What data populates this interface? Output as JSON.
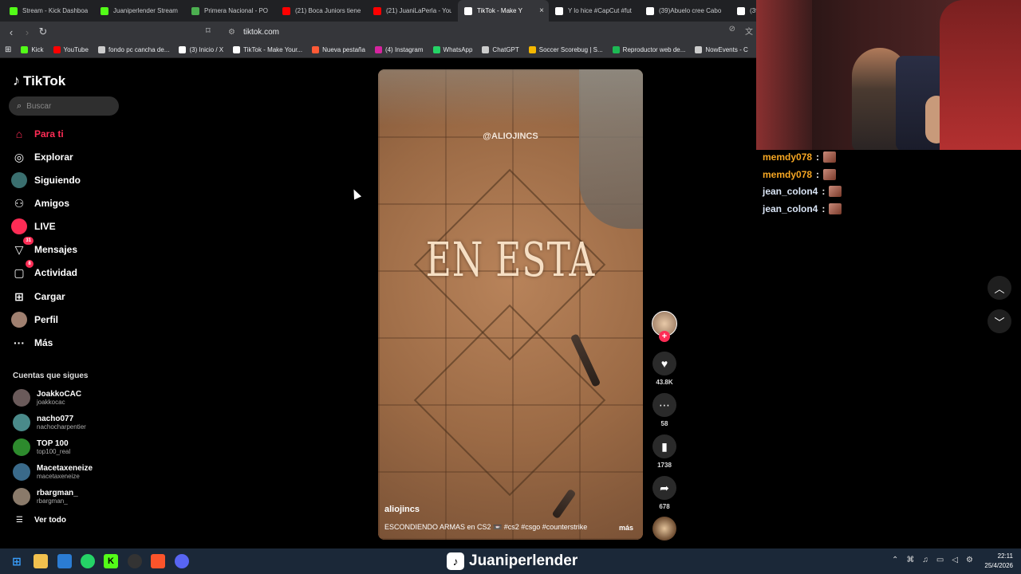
{
  "browser": {
    "tabs": [
      {
        "label": "Stream - Kick Dashboa",
        "icon": "kick-icon",
        "color": "#53fc18",
        "active": false
      },
      {
        "label": "Juaniperlender Stream",
        "icon": "kick-icon",
        "color": "#53fc18",
        "active": false
      },
      {
        "label": "Primera Nacional - PO",
        "icon": "sports-icon",
        "color": "#4caf50",
        "active": false
      },
      {
        "label": "(21) Boca Juniors tiene",
        "icon": "youtube-icon",
        "color": "#ff0000",
        "active": false
      },
      {
        "label": "(21) JuaniLaPerla - You",
        "icon": "youtube-icon",
        "color": "#ff0000",
        "active": false
      },
      {
        "label": "TikTok - Make Y",
        "icon": "tiktok-icon",
        "color": "#ffffff",
        "active": true
      },
      {
        "label": "Y lo hice #CapCut #fut",
        "icon": "tiktok-icon",
        "color": "#ffffff",
        "active": false
      },
      {
        "label": "(39)Abuelo cree Cabo",
        "icon": "tiktok-icon",
        "color": "#ffffff",
        "active": false
      },
      {
        "label": "(39",
        "icon": "tiktok-icon",
        "color": "#ffffff",
        "active": false
      }
    ],
    "url": "tiktok.com",
    "bookmarks": [
      {
        "label": "Kick",
        "color": "#53fc18"
      },
      {
        "label": "YouTube",
        "color": "#ff0000"
      },
      {
        "label": "fondo pc cancha de...",
        "color": "#cccccc"
      },
      {
        "label": "(3) Inicio / X",
        "color": "#ffffff"
      },
      {
        "label": "TikTok - Make Your...",
        "color": "#ffffff"
      },
      {
        "label": "Nueva pestaña",
        "color": "#ff5a36"
      },
      {
        "label": "(4) Instagram",
        "color": "#d6249f"
      },
      {
        "label": "WhatsApp",
        "color": "#25d366"
      },
      {
        "label": "ChatGPT",
        "color": "#cccccc"
      },
      {
        "label": "Soccer Scorebug | S...",
        "color": "#f5b800"
      },
      {
        "label": "Reproductor web de...",
        "color": "#1db954"
      },
      {
        "label": "NowEvents - C",
        "color": "#cccccc"
      }
    ]
  },
  "sidebar": {
    "logo": "TikTok",
    "search_placeholder": "Buscar",
    "nav": [
      {
        "label": "Para ti",
        "icon": "home-icon",
        "glyph": "⌂",
        "badge": ""
      },
      {
        "label": "Explorar",
        "icon": "compass-icon",
        "glyph": "◎",
        "badge": ""
      },
      {
        "label": "Siguiendo",
        "icon": "following-icon",
        "glyph": "●",
        "badge": ""
      },
      {
        "label": "Amigos",
        "icon": "friends-icon",
        "glyph": "⚇",
        "badge": ""
      },
      {
        "label": "LIVE",
        "icon": "live-icon",
        "glyph": "●",
        "badge": ""
      },
      {
        "label": "Mensajes",
        "icon": "messages-icon",
        "glyph": "▽",
        "badge": "31"
      },
      {
        "label": "Actividad",
        "icon": "activity-icon",
        "glyph": "▢",
        "badge": "8"
      },
      {
        "label": "Cargar",
        "icon": "upload-icon",
        "glyph": "⊞",
        "badge": ""
      },
      {
        "label": "Perfil",
        "icon": "profile-icon",
        "glyph": "●",
        "badge": ""
      },
      {
        "label": "Más",
        "icon": "more-icon",
        "glyph": "···",
        "badge": ""
      }
    ],
    "following_title": "Cuentas que sigues",
    "accounts": [
      {
        "name": "JoakkoCAC",
        "handle": "joakkocac"
      },
      {
        "name": "nacho077",
        "handle": "nachocharpentier"
      },
      {
        "name": "TOP 100",
        "handle": "top100_real"
      },
      {
        "name": "Macetaxeneize",
        "handle": "macetaxeneize"
      },
      {
        "name": "rbargman_",
        "handle": "rbargman_"
      }
    ],
    "see_all": "Ver todo"
  },
  "video": {
    "watermark": "@ALIOJINCS",
    "overlay_text": "EN ESTA",
    "author": "aliojincs",
    "description": "ESCONDIENDO ARMAS en CS2 📼 #cs2 #csgo #counterstrike",
    "more": "más",
    "likes": "43.8K",
    "comments": "58",
    "saves": "1738",
    "shares": "678"
  },
  "chat": [
    {
      "user": "memdy078",
      "color": "#f5a623"
    },
    {
      "user": "memdy078",
      "color": "#f5a623"
    },
    {
      "user": "jean_colon4",
      "color": "#d9e4f5"
    },
    {
      "user": "jean_colon4",
      "color": "#d9e4f5"
    }
  ],
  "stream": {
    "streamer_name": "Juaniperlender"
  },
  "taskbar": {
    "time": "22:11",
    "date": "25/4/2026"
  }
}
